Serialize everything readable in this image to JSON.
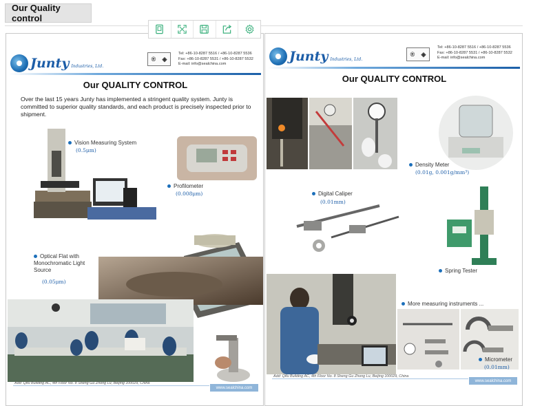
{
  "section": {
    "title": "Our Quality control"
  },
  "toolbar": {
    "buttons": [
      {
        "icon": "bookmark-icon",
        "label": ""
      },
      {
        "icon": "fullscreen-icon",
        "label": ""
      },
      {
        "icon": "save-icon",
        "label": ""
      },
      {
        "icon": "share-icon",
        "label": ""
      },
      {
        "icon": "settings-icon",
        "label": ""
      }
    ],
    "accent": "#3bb07d"
  },
  "brand": {
    "name": "Junty",
    "sub": "Industries, Ltd."
  },
  "contact": {
    "lines": "Tel: +86-10-8287 5516 / +86-10-8287 5536\nFax: +86-10-8287 5531 / +86-10-8287 5532\nE-mail: info@sealchina.com"
  },
  "left_page": {
    "title": "Our QUALITY CONTROL",
    "intro": "Over the last 15 years Junty has implemented a stringent quality system. Junty is committed to superior quality standards, and each product is precisely inspected prior to shipment.",
    "items": [
      {
        "label": "Vision Measuring System",
        "spec": "(0.5μm)"
      },
      {
        "label": "Profilometer",
        "spec": "(0.008μm)"
      },
      {
        "label": "Optical Flat with Monochromatic Light Source",
        "spec": "(0.05μm)"
      }
    ],
    "footer_address": "Add: Qifu Building AC, 4th Floor No. 8 Sheng Gu Zhong Lu, Beijing 100029, China",
    "footer_url": "www.sealchina.com"
  },
  "right_page": {
    "title": "Our QUALITY CONTROL",
    "items": [
      {
        "label": "Density Meter",
        "spec": "(0.01g, 0.001g/mm³)"
      },
      {
        "label": "Digital Caliper",
        "spec": "(0.01mm)"
      },
      {
        "label": "Spring Tester",
        "spec": ""
      },
      {
        "label": "More measuring instruments ...",
        "spec": ""
      },
      {
        "label": "Micrometer",
        "spec": "(0.01mm)"
      }
    ],
    "footer_address": "Add: Qifu Building AC, 4th Floor No. 8 Sheng Gu Zhong Lu, Beijing 100029, China",
    "footer_url": "www.sealchina.com"
  }
}
